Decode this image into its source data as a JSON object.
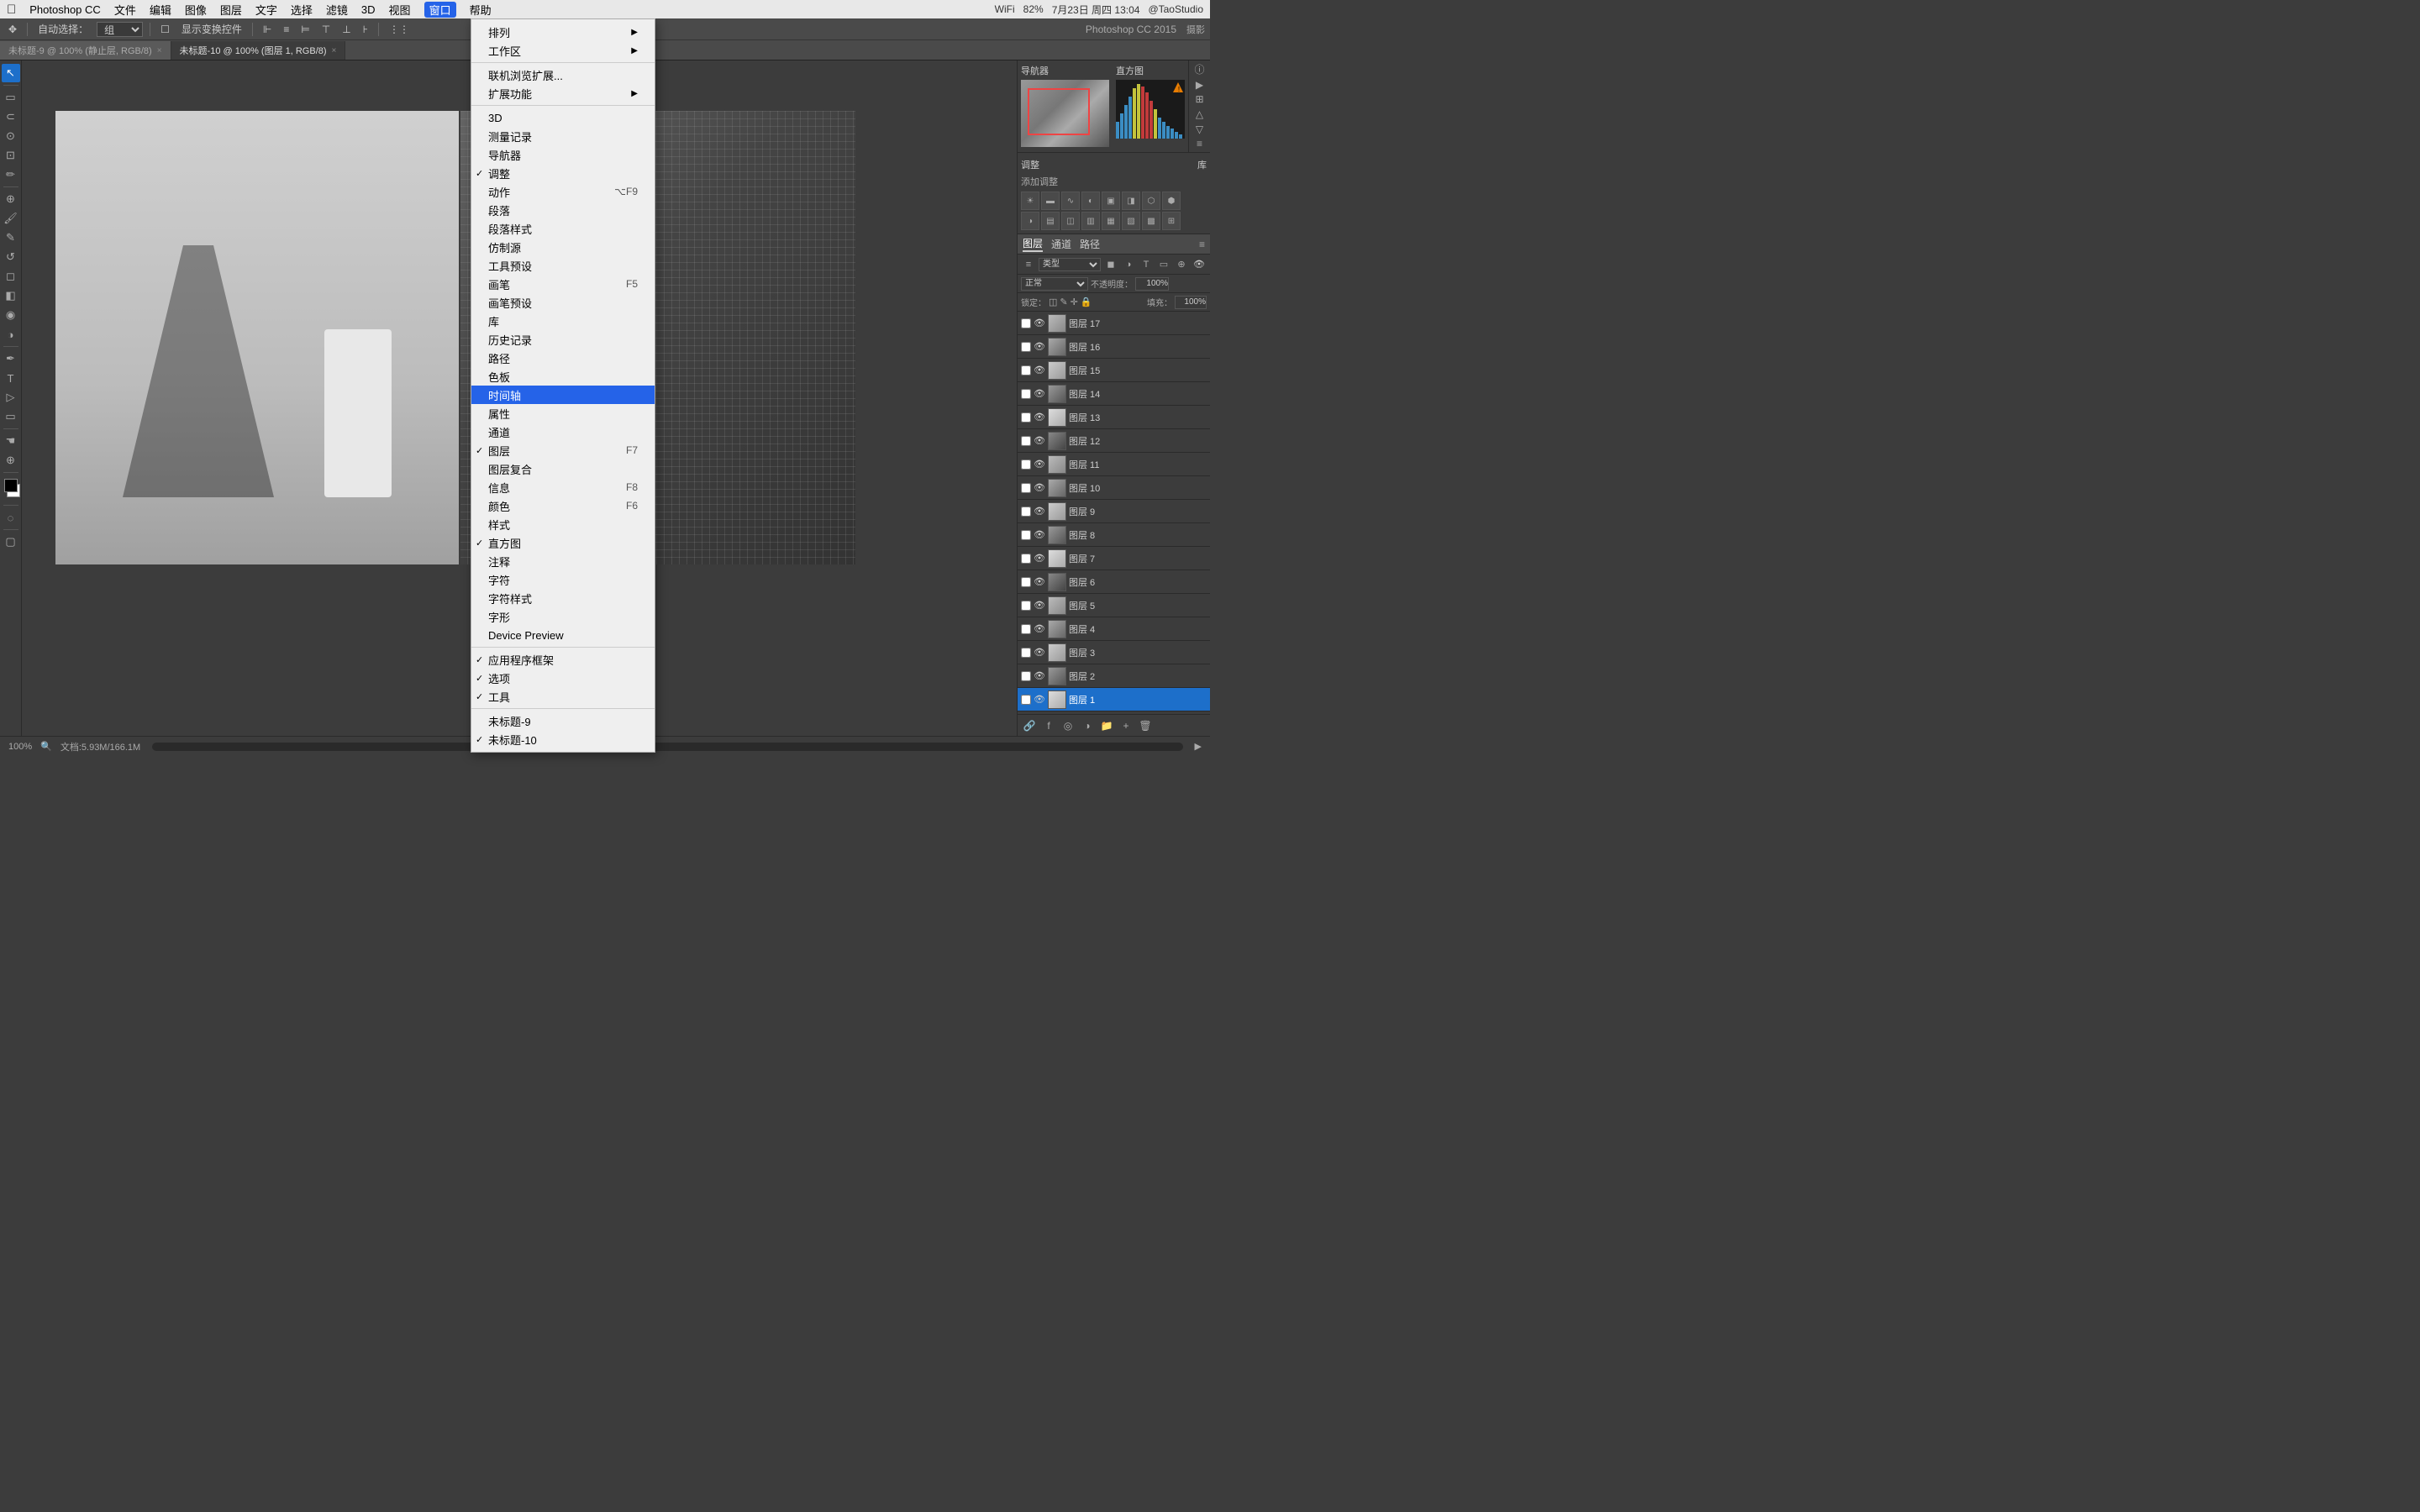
{
  "menubar": {
    "apple": "⌘",
    "items": [
      "Photoshop CC",
      "文件",
      "编辑",
      "图像",
      "图层",
      "文字",
      "选择",
      "滤镜",
      "3D",
      "视图",
      "窗口",
      "帮助"
    ],
    "active_item": "窗口",
    "right": {
      "wifi": "2",
      "battery": "82%",
      "date": "7月23日 周四 13:04",
      "user": "@TaoStudio"
    }
  },
  "toolbar": {
    "auto_select_label": "自动选择：",
    "auto_select_type": "组",
    "show_controls": "显示变换控件",
    "ps_version": "Photoshop CC 2015"
  },
  "tabs": [
    {
      "label": "未标题-9 @ 100% (静止层, RGB/8)",
      "active": false
    },
    {
      "label": "未标题-10 @ 100% (图层 1, RGB/8)",
      "active": true
    }
  ],
  "dropdown": {
    "items": [
      {
        "label": "排列",
        "has_sub": true,
        "check": false
      },
      {
        "label": "工作区",
        "has_sub": true,
        "check": false
      },
      {
        "separator": true
      },
      {
        "label": "联机浏览扩展...",
        "check": false
      },
      {
        "label": "扩展功能",
        "has_sub": true,
        "check": false
      },
      {
        "separator": true
      },
      {
        "label": "3D",
        "check": false
      },
      {
        "label": "测量记录",
        "check": false
      },
      {
        "label": "导航器",
        "check": false
      },
      {
        "label": "调整",
        "check": true
      },
      {
        "label": "动作",
        "shortcut": "⌥F9",
        "check": false
      },
      {
        "label": "段落",
        "check": false
      },
      {
        "label": "段落样式",
        "check": false
      },
      {
        "label": "仿制源",
        "check": false
      },
      {
        "label": "工具预设",
        "check": false
      },
      {
        "label": "画笔",
        "shortcut": "F5",
        "check": false
      },
      {
        "label": "画笔预设",
        "check": false
      },
      {
        "label": "库",
        "check": false
      },
      {
        "label": "历史记录",
        "check": false
      },
      {
        "label": "路径",
        "check": false
      },
      {
        "label": "色板",
        "check": false
      },
      {
        "label": "时间轴",
        "highlighted": true,
        "check": false
      },
      {
        "label": "属性",
        "check": false
      },
      {
        "label": "通道",
        "check": false
      },
      {
        "label": "图层",
        "shortcut": "F7",
        "check": true
      },
      {
        "label": "图层复合",
        "check": false
      },
      {
        "label": "信息",
        "shortcut": "F8",
        "check": false
      },
      {
        "label": "颜色",
        "shortcut": "F6",
        "check": false
      },
      {
        "label": "样式",
        "check": false
      },
      {
        "label": "直方图",
        "check": true
      },
      {
        "label": "注释",
        "check": false
      },
      {
        "label": "字符",
        "check": false
      },
      {
        "label": "字符样式",
        "check": false
      },
      {
        "label": "字形",
        "check": false
      },
      {
        "label": "Device Preview",
        "check": false
      },
      {
        "separator": true
      },
      {
        "label": "应用程序框架",
        "check": true
      },
      {
        "label": "选项",
        "check": true
      },
      {
        "label": "工具",
        "check": true
      },
      {
        "separator": true
      },
      {
        "label": "未标题-9",
        "check": false
      },
      {
        "label": "未标题-10",
        "check": true
      }
    ]
  },
  "right_panel": {
    "navigator_label": "直方图",
    "navigator_label2": "导航器",
    "adjust_label": "调整",
    "library_label": "库",
    "add_adjust": "添加调整",
    "layers": {
      "tabs": [
        "图层",
        "通道",
        "路径"
      ],
      "active_tab": "图层",
      "blend_mode": "正常",
      "opacity": "100%",
      "fill": "100%",
      "lock_label": "锁定：",
      "rows": [
        {
          "name": "图层 17",
          "visible": true,
          "selected": false
        },
        {
          "name": "图层 16",
          "visible": true,
          "selected": false
        },
        {
          "name": "图层 15",
          "visible": true,
          "selected": false
        },
        {
          "name": "图层 14",
          "visible": true,
          "selected": false
        },
        {
          "name": "图层 13",
          "visible": true,
          "selected": false
        },
        {
          "name": "图层 12",
          "visible": true,
          "selected": false
        },
        {
          "name": "图层 11",
          "visible": true,
          "selected": false
        },
        {
          "name": "图层 10",
          "visible": true,
          "selected": false
        },
        {
          "name": "图层 9",
          "visible": true,
          "selected": false
        },
        {
          "name": "图层 8",
          "visible": true,
          "selected": false
        },
        {
          "name": "图层 7",
          "visible": true,
          "selected": false
        },
        {
          "name": "图层 6",
          "visible": true,
          "selected": false
        },
        {
          "name": "图层 5",
          "visible": true,
          "selected": false
        },
        {
          "name": "图层 4",
          "visible": true,
          "selected": false
        },
        {
          "name": "图层 3",
          "visible": true,
          "selected": false
        },
        {
          "name": "图层 2",
          "visible": true,
          "selected": false
        },
        {
          "name": "图层 1",
          "visible": true,
          "selected": true
        }
      ]
    }
  },
  "status_bar": {
    "zoom": "100%",
    "doc_size": "文档:5.93M/166.1M"
  }
}
